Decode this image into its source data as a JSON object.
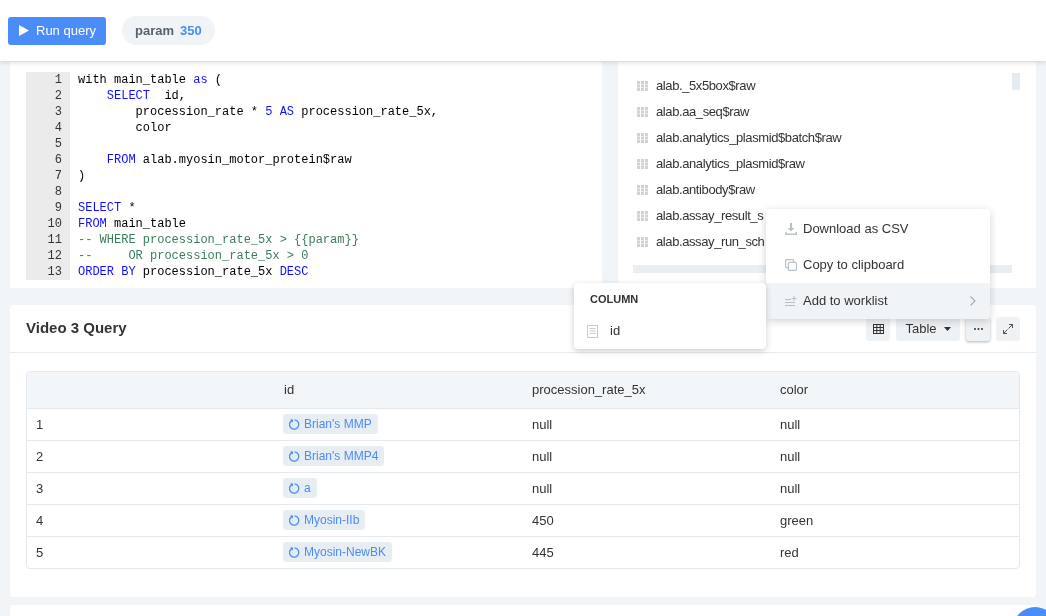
{
  "toolbar": {
    "run_button": {
      "label": "Run query"
    },
    "parameter": {
      "name": "param",
      "value": "350"
    }
  },
  "editor": {
    "lines": [
      {
        "number": "1",
        "tokens": [
          {
            "kind": "plain",
            "text": "with main_table "
          },
          {
            "kind": "keyword",
            "text": "as"
          },
          {
            "kind": "plain",
            "text": " ("
          }
        ]
      },
      {
        "number": "2",
        "tokens": [
          {
            "kind": "keyword",
            "text": "    SELECT"
          },
          {
            "kind": "plain",
            "text": "  id,"
          }
        ]
      },
      {
        "number": "3",
        "tokens": [
          {
            "kind": "plain",
            "text": "        procession_rate * "
          },
          {
            "kind": "number",
            "text": "5"
          },
          {
            "kind": "keyword",
            "text": " AS"
          },
          {
            "kind": "plain",
            "text": " procession_rate_5x,"
          }
        ]
      },
      {
        "number": "4",
        "tokens": [
          {
            "kind": "plain",
            "text": "        color"
          }
        ]
      },
      {
        "number": "5"
      },
      {
        "number": "6",
        "tokens": [
          {
            "kind": "keyword",
            "text": "    FROM"
          },
          {
            "kind": "plain",
            "text": " alab.myosin_motor_protein$raw"
          }
        ]
      },
      {
        "number": "7",
        "tokens": [
          {
            "kind": "plain",
            "text": ")"
          }
        ]
      },
      {
        "number": "8"
      },
      {
        "number": "9",
        "tokens": [
          {
            "kind": "keyword",
            "text": "SELECT"
          },
          {
            "kind": "plain",
            "text": " *"
          }
        ]
      },
      {
        "number": "10",
        "tokens": [
          {
            "kind": "keyword",
            "text": "FROM"
          },
          {
            "kind": "plain",
            "text": " main_table"
          }
        ]
      },
      {
        "number": "11",
        "tokens": [
          {
            "kind": "comment",
            "text": "-- WHERE procession_rate_5x > {{param}}"
          }
        ]
      },
      {
        "number": "12",
        "tokens": [
          {
            "kind": "comment",
            "text": "--     OR procession_rate_5x > 0"
          }
        ]
      },
      {
        "number": "13",
        "tokens": [
          {
            "kind": "keyword",
            "text": "ORDER BY"
          },
          {
            "kind": "plain",
            "text": " procession_rate_5x "
          },
          {
            "kind": "keyword",
            "text": "DESC"
          }
        ]
      }
    ]
  },
  "table_browser": {
    "items": [
      {
        "label": "alab._5x5box$raw"
      },
      {
        "label": "alab.aa_seq$raw"
      },
      {
        "label": "alab.analytics_plasmid$batch$raw"
      },
      {
        "label": "alab.analytics_plasmid$raw"
      },
      {
        "label": "alab.antibody$raw"
      },
      {
        "label": "alab.assay_result_s"
      },
      {
        "label": "alab.assay_run_sch"
      }
    ]
  },
  "context_menu": {
    "items": [
      {
        "kind": "download",
        "label": "Download as CSV",
        "selected": false,
        "has_submenu": false
      },
      {
        "kind": "copy",
        "label": "Copy to clipboard",
        "selected": false,
        "has_submenu": false
      },
      {
        "kind": "worklist",
        "label": "Add to worklist",
        "selected": true,
        "has_submenu": true
      }
    ]
  },
  "submenu": {
    "heading": "COLUMN",
    "items": [
      {
        "label": "id"
      }
    ]
  },
  "result_panel": {
    "title": "Video 3 Query",
    "view_mode": "Table",
    "more_menu_open": true,
    "table": {
      "columns": [
        "id",
        "procession_rate_5x",
        "color"
      ],
      "rows": [
        {
          "number": "1",
          "cells": [
            {
              "kind": "entity",
              "text": "Brian's MMP"
            },
            {
              "kind": "text",
              "text": "null"
            },
            {
              "kind": "text",
              "text": "null"
            }
          ]
        },
        {
          "number": "2",
          "cells": [
            {
              "kind": "entity",
              "text": "Brian's MMP4"
            },
            {
              "kind": "text",
              "text": "null"
            },
            {
              "kind": "text",
              "text": "null"
            }
          ]
        },
        {
          "number": "3",
          "cells": [
            {
              "kind": "entity",
              "text": "a"
            },
            {
              "kind": "text",
              "text": "null"
            },
            {
              "kind": "text",
              "text": "null"
            }
          ]
        },
        {
          "number": "4",
          "cells": [
            {
              "kind": "entity",
              "text": "Myosin-IIb"
            },
            {
              "kind": "text",
              "text": "450"
            },
            {
              "kind": "text",
              "text": "green"
            }
          ]
        },
        {
          "number": "5",
          "cells": [
            {
              "kind": "entity",
              "text": "Myosin-NewBK"
            },
            {
              "kind": "text",
              "text": "445"
            },
            {
              "kind": "text",
              "text": "red"
            }
          ]
        }
      ]
    }
  }
}
